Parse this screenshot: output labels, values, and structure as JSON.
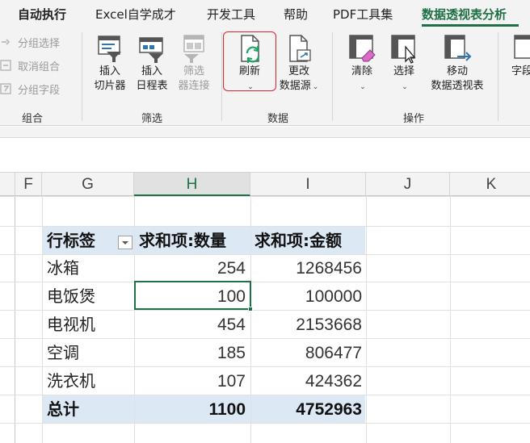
{
  "tabs": [
    {
      "label": "自动执行"
    },
    {
      "label": "Excel自学成才"
    },
    {
      "label": "开发工具"
    },
    {
      "label": "帮助"
    },
    {
      "label": "PDF工具集"
    },
    {
      "label": "数据透视表分析"
    }
  ],
  "ribbon": {
    "group_items": [
      {
        "label": "分组选择",
        "icon": "group-selection-icon"
      },
      {
        "label": "取消组合",
        "icon": "ungroup-icon"
      },
      {
        "label": "分组字段",
        "icon": "group-field-icon"
      }
    ],
    "group_label": "组合",
    "filter": {
      "label": "筛选",
      "buttons": [
        {
          "line1": "插入",
          "line2": "切片器",
          "icon": "slicer-icon"
        },
        {
          "line1": "插入",
          "line2": "日程表",
          "icon": "timeline-icon"
        },
        {
          "line1": "筛选",
          "line2": "器连接",
          "icon": "filter-connection-icon"
        }
      ]
    },
    "data": {
      "label": "数据",
      "refresh": {
        "label": "刷新",
        "icon": "refresh-icon"
      },
      "change_source": {
        "line1": "更改",
        "line2": "数据源",
        "icon": "change-source-icon"
      }
    },
    "actions": {
      "label": "操作",
      "buttons": [
        {
          "label": "清除",
          "icon": "clear-icon"
        },
        {
          "label": "选择",
          "icon": "select-icon"
        },
        {
          "line1": "移动",
          "line2": "数据透视表",
          "icon": "move-pivot-icon"
        }
      ]
    },
    "overflow_label": "字段"
  },
  "columns": [
    "F",
    "G",
    "H",
    "I",
    "J",
    "K"
  ],
  "pivot": {
    "headers": {
      "row_label": "行标签",
      "qty": "求和项:数量",
      "amount": "求和项:金额"
    },
    "rows": [
      {
        "name": "冰箱",
        "qty": "254",
        "amount": "1268456"
      },
      {
        "name": "电饭煲",
        "qty": "100",
        "amount": "100000"
      },
      {
        "name": "电视机",
        "qty": "454",
        "amount": "2153668"
      },
      {
        "name": "空调",
        "qty": "185",
        "amount": "806477"
      },
      {
        "name": "洗衣机",
        "qty": "107",
        "amount": "424362"
      }
    ],
    "total": {
      "label": "总计",
      "qty": "1100",
      "amount": "4752963"
    }
  },
  "colors": {
    "accent": "#1e7145",
    "pivot_band": "#dce9f5",
    "highlight_border": "#e0222c"
  }
}
